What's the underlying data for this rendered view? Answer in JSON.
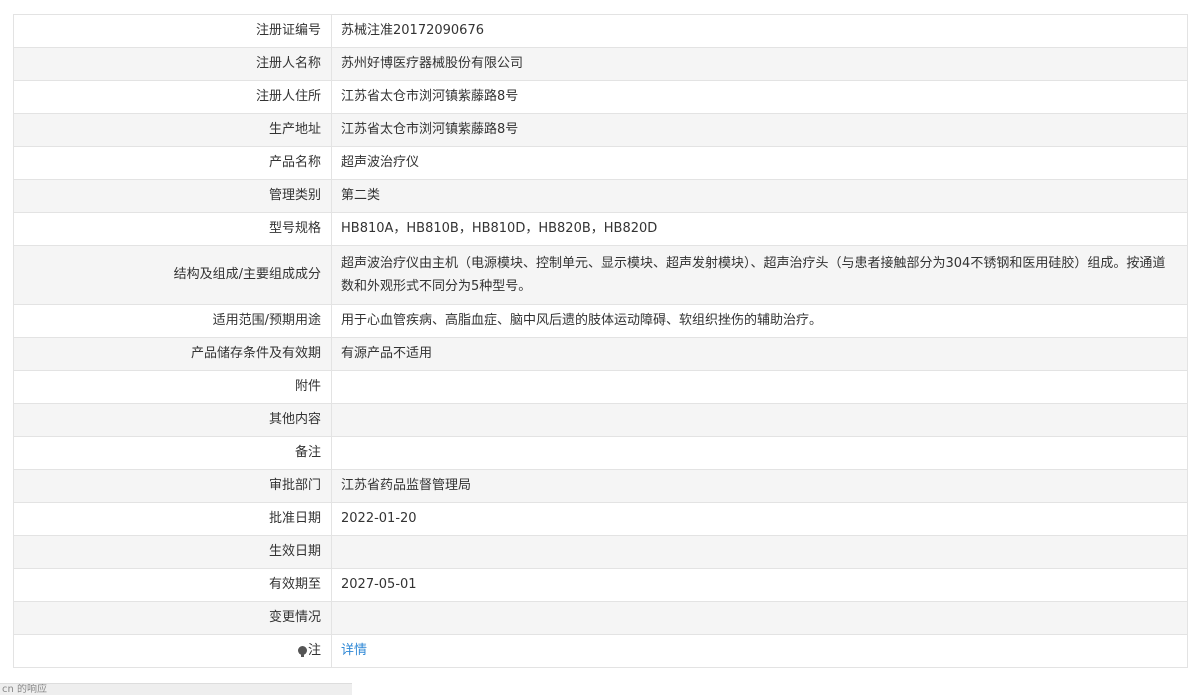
{
  "rows": [
    {
      "label": "注册证编号",
      "value": "苏械注准20172090676"
    },
    {
      "label": "注册人名称",
      "value": "苏州好博医疗器械股份有限公司"
    },
    {
      "label": "注册人住所",
      "value": "江苏省太仓市浏河镇紫藤路8号"
    },
    {
      "label": "生产地址",
      "value": "江苏省太仓市浏河镇紫藤路8号"
    },
    {
      "label": "产品名称",
      "value": "超声波治疗仪"
    },
    {
      "label": "管理类别",
      "value": "第二类"
    },
    {
      "label": "型号规格",
      "value": "HB810A，HB810B，HB810D，HB820B，HB820D"
    },
    {
      "label": "结构及组成/主要组成成分",
      "value": "超声波治疗仪由主机（电源模块、控制单元、显示模块、超声发射模块）、超声治疗头（与患者接触部分为304不锈钢和医用硅胶）组成。按通道数和外观形式不同分为5种型号。"
    },
    {
      "label": "适用范围/预期用途",
      "value": "用于心血管疾病、高脂血症、脑中风后遗的肢体运动障碍、软组织挫伤的辅助治疗。"
    },
    {
      "label": "产品储存条件及有效期",
      "value": "有源产品不适用"
    },
    {
      "label": "附件",
      "value": ""
    },
    {
      "label": "其他内容",
      "value": ""
    },
    {
      "label": "备注",
      "value": ""
    },
    {
      "label": "审批部门",
      "value": "江苏省药品监督管理局"
    },
    {
      "label": "批准日期",
      "value": "2022-01-20"
    },
    {
      "label": "生效日期",
      "value": ""
    },
    {
      "label": "有效期至",
      "value": "2027-05-01"
    },
    {
      "label": "变更情况",
      "value": ""
    }
  ],
  "note_row": {
    "label": "注",
    "link": "详情",
    "icon": "tip-bulb-icon"
  },
  "bottom_bar": {
    "text": "cn 的响应"
  }
}
